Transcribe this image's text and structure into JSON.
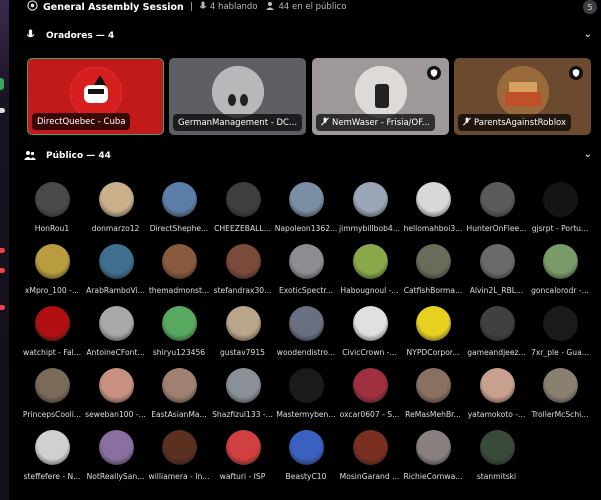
{
  "topbar": {
    "title": "General Assembly Session",
    "speaking": "4 hablando",
    "public": "44 en el público",
    "badge": "5"
  },
  "speakers_section": {
    "label": "Oradores — 4"
  },
  "audience_section": {
    "label": "Público — 44"
  },
  "speakers": [
    {
      "label": "DirectQuebec - Cuba",
      "bg": "#c2191a",
      "muted": false,
      "badge": false
    },
    {
      "label": "GermanManagement - DC...",
      "bg": "#57595e",
      "muted": false,
      "badge": false
    },
    {
      "label": "NemWaser - Frisia/OF...",
      "bg": "#a09b9a",
      "muted": true,
      "badge": true
    },
    {
      "label": "ParentsAgainstRoblox",
      "bg": "#6b4a30",
      "muted": true,
      "badge": true
    }
  ],
  "audience": [
    {
      "name": "HonRou1",
      "color": "#4a4a4a"
    },
    {
      "name": "donmarzo12",
      "color": "#c9b08a"
    },
    {
      "name": "DirectShephe...",
      "color": "#5b7fa8"
    },
    {
      "name": "CHEEZEBALL...",
      "color": "#3e3e3e"
    },
    {
      "name": "Napoleon1362...",
      "color": "#7a8ea5"
    },
    {
      "name": "jimmybillbob4...",
      "color": "#9aa5b5"
    },
    {
      "name": "hellomahboi3...",
      "color": "#d8d8d8"
    },
    {
      "name": "HunterOnFlee...",
      "color": "#5a5a5a"
    },
    {
      "name": "gjsrpt - Portu...",
      "color": "#141414"
    },
    {
      "name": "xMpro_100 -...",
      "color": "#b89c3e"
    },
    {
      "name": "ArabRamboVi...",
      "color": "#3f6f8f"
    },
    {
      "name": "themadmonst...",
      "color": "#8a5a3e"
    },
    {
      "name": "stefandrax30...",
      "color": "#7a4a3a"
    },
    {
      "name": "ExoticSpectr...",
      "color": "#8c8c92"
    },
    {
      "name": "Habougnoul -...",
      "color": "#8aa84a"
    },
    {
      "name": "CatfishBorma...",
      "color": "#6b6b5a"
    },
    {
      "name": "Alvin2L_RBL...",
      "color": "#6a6a6a"
    },
    {
      "name": "goncalorodr -...",
      "color": "#7a9a6a"
    },
    {
      "name": "watchipt - Fal...",
      "color": "#b01010"
    },
    {
      "name": "AntoineCFont...",
      "color": "#a8a8a8"
    },
    {
      "name": "shiryu123456",
      "color": "#58a860"
    },
    {
      "name": "gustav7915",
      "color": "#b8a58a"
    },
    {
      "name": "woodendistro...",
      "color": "#6a7080"
    },
    {
      "name": "CivicCrown -...",
      "color": "#e0e0e0"
    },
    {
      "name": "NYPDCorpor...",
      "color": "#e8d020"
    },
    {
      "name": "gameandjeez...",
      "color": "#404040"
    },
    {
      "name": "7xr_ple - Gua...",
      "color": "#1a1a1a"
    },
    {
      "name": "PrincepsCooli...",
      "color": "#7a6a5a"
    },
    {
      "name": "seweban100 -...",
      "color": "#c89080"
    },
    {
      "name": "EastAsianMa...",
      "color": "#a08070"
    },
    {
      "name": "Shazfizul133 -...",
      "color": "#8a9098"
    },
    {
      "name": "Mastermyben...",
      "color": "#1a1a1a"
    },
    {
      "name": "oxcar0607 - S...",
      "color": "#a03040"
    },
    {
      "name": "ReMasMehBr...",
      "color": "#8a7060"
    },
    {
      "name": "yatamokoto -...",
      "color": "#c8a090"
    },
    {
      "name": "TrollerMcSchi...",
      "color": "#8a8070"
    },
    {
      "name": "steffefere - N...",
      "color": "#d0d0d0"
    },
    {
      "name": "NotReallySan...",
      "color": "#8a70a0"
    },
    {
      "name": "williamera - In...",
      "color": "#5a3020"
    },
    {
      "name": "wafturi - ISP",
      "color": "#d04040"
    },
    {
      "name": "BeastyC10",
      "color": "#3a60c0"
    },
    {
      "name": "MosinGarand ...",
      "color": "#7a3020"
    },
    {
      "name": "RichieCornwa...",
      "color": "#8a8080"
    },
    {
      "name": "stanmitski",
      "color": "#3a4a3a"
    }
  ]
}
